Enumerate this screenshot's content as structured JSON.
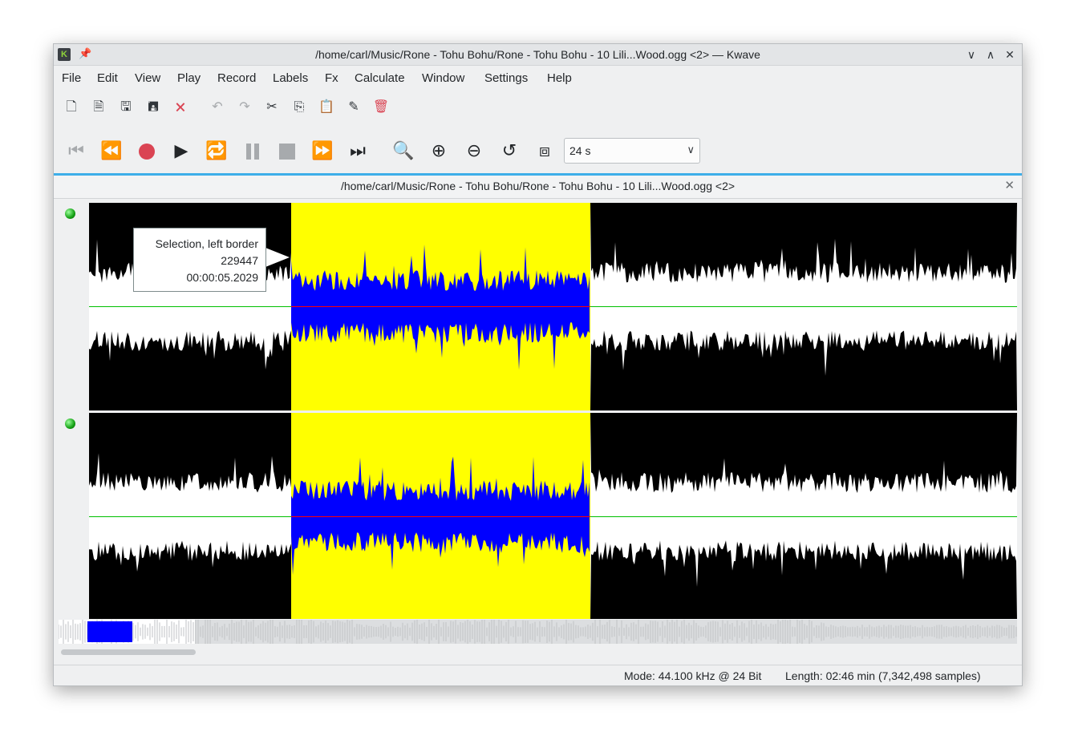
{
  "window": {
    "title": "/home/carl/Music/Rone - Tohu Bohu/Rone - Tohu Bohu - 10 Lili...Wood.ogg <2> — Kwave",
    "app_icon_text": "K",
    "controls": [
      "minimize",
      "maximize",
      "close"
    ]
  },
  "menu": {
    "items": [
      "File",
      "Edit",
      "View",
      "Play",
      "Record",
      "Labels",
      "Fx",
      "Calculate",
      "Window",
      "Settings",
      "Help"
    ]
  },
  "toolbar": {
    "file_actions": [
      "new-file-icon",
      "open-file-icon",
      "save-icon",
      "save-as-icon",
      "close-file-icon"
    ],
    "edit_actions": [
      "undo-icon",
      "redo-icon",
      "cut-icon",
      "copy-icon",
      "paste-icon",
      "erase-icon",
      "delete-icon"
    ]
  },
  "transport": {
    "buttons": [
      "skip-to-start-icon",
      "rewind-icon",
      "record-icon",
      "play-icon",
      "loop-icon",
      "pause-icon",
      "stop-icon",
      "fast-forward-icon",
      "skip-to-end-icon"
    ],
    "zoom_buttons": [
      "zoom-to-selection-icon",
      "zoom-in-icon",
      "zoom-out-icon",
      "zoom-reset-icon",
      "zoom-all-icon"
    ],
    "zoom_value": "24 s"
  },
  "document": {
    "tab_title": "/home/carl/Music/Rone - Tohu Bohu/Rone - Tohu Bohu - 10 Lili...Wood.ogg <2>"
  },
  "tooltip": {
    "line1": "Selection, left border",
    "line2": "229447",
    "line3": "00:00:05.2029"
  },
  "colors": {
    "selection_bg": "#ffff00",
    "selection_wave": "#0000ff",
    "wave_fill": "#000000",
    "zero_line": "#00c000",
    "accent": "#3daee9",
    "led": "#14a014"
  },
  "status": {
    "mode": "Mode: 44.100 kHz @ 24 Bit",
    "length": "Length: 02:46 min (7,342,498 samples)"
  },
  "tracks": [
    {
      "name": "track-1",
      "selected_fraction_start": 0.218,
      "selected_fraction_end": 0.54
    },
    {
      "name": "track-2",
      "selected_fraction_start": 0.218,
      "selected_fraction_end": 0.54
    }
  ]
}
